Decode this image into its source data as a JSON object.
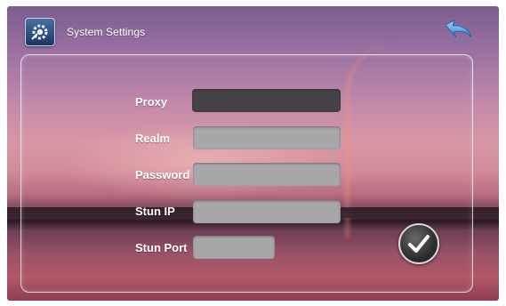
{
  "header": {
    "title": "System Settings",
    "icon": "settings-gear-icon",
    "back_icon": "back-arrow-icon"
  },
  "form": {
    "fields": [
      {
        "label": "Proxy",
        "value": ""
      },
      {
        "label": "Realm",
        "value": ""
      },
      {
        "label": "Password",
        "value": ""
      },
      {
        "label": "Stun IP",
        "value": ""
      },
      {
        "label": "Stun Port",
        "value": ""
      }
    ]
  },
  "actions": {
    "confirm_icon": "checkmark-icon"
  },
  "colors": {
    "field_bg": "#a7a6a8",
    "field_active_bg": "#454346",
    "accent_blue": "#3aa0e6"
  }
}
